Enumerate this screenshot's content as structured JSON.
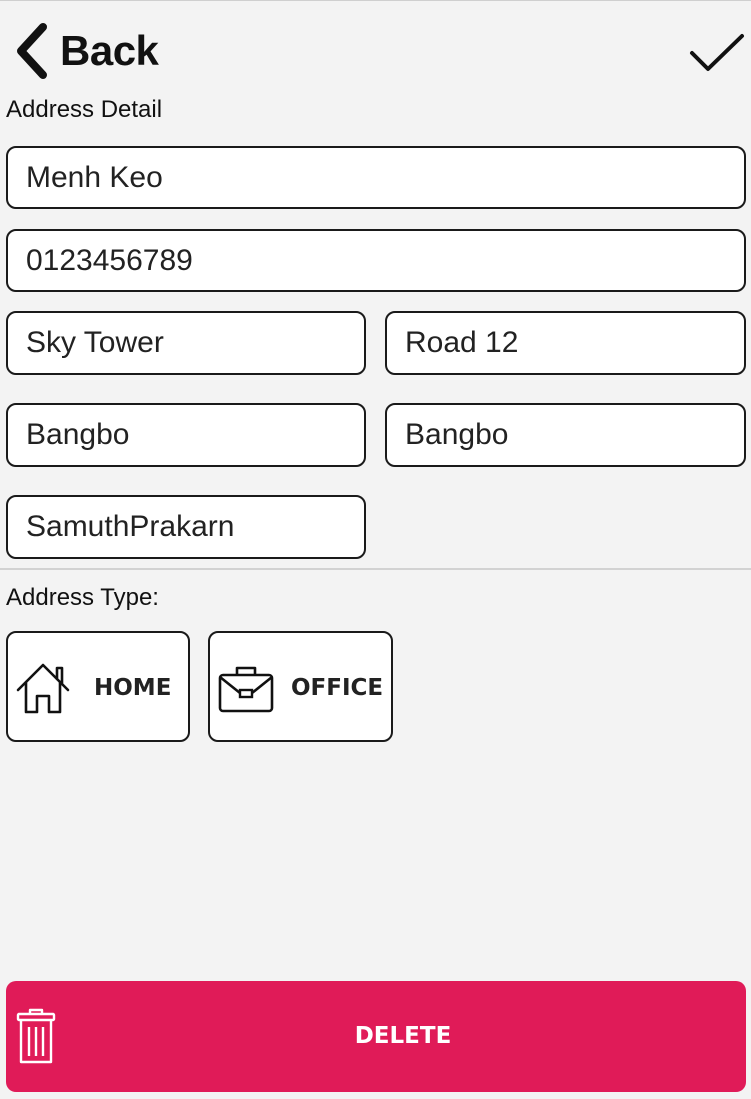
{
  "header": {
    "back_label": "Back"
  },
  "address_detail": {
    "section_label": "Address Detail",
    "name": "Menh Keo",
    "phone": "0123456789",
    "building": "Sky Tower",
    "road": "Road 12",
    "district": "Bangbo",
    "subdistrict": "Bangbo",
    "province": "SamuthPrakarn"
  },
  "address_type": {
    "section_label": "Address Type:",
    "options": [
      {
        "label": "HOME",
        "icon": "house-icon"
      },
      {
        "label": "OFFICE",
        "icon": "briefcase-icon"
      }
    ]
  },
  "footer": {
    "delete_label": "DELETE",
    "delete_icon": "trash-icon",
    "delete_color": "#e01b58"
  }
}
